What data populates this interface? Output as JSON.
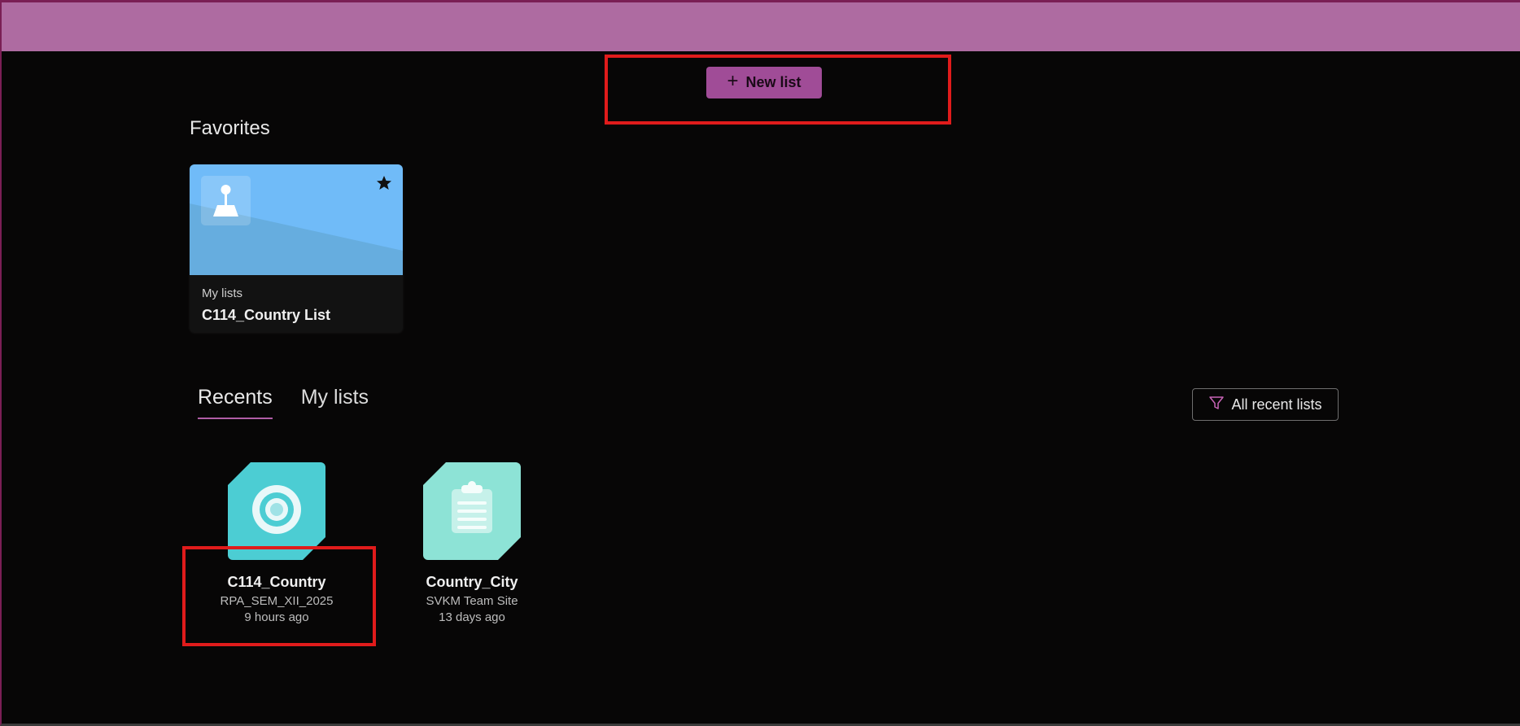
{
  "header": {
    "band_color": "#ae6ba1"
  },
  "toolbar": {
    "new_list_label": "New list",
    "accent": "#a04c97"
  },
  "favorites": {
    "title": "Favorites",
    "cards": [
      {
        "subtitle": "My lists",
        "title": "C114_Country List",
        "starred": true,
        "icon": "joystick-icon",
        "color": "#6fb8f7"
      }
    ]
  },
  "tabs": [
    {
      "label": "Recents",
      "active": true
    },
    {
      "label": "My lists",
      "active": false
    }
  ],
  "filter": {
    "label": "All recent lists",
    "icon": "filter-icon"
  },
  "recents": [
    {
      "name": "C114_Country",
      "site": "RPA_SEM_XII_2025",
      "time": "9 hours ago",
      "icon": "target-icon",
      "color": "#4ccdd3"
    },
    {
      "name": "Country_City",
      "site": "SVKM Team Site",
      "time": "13 days ago",
      "icon": "clipboard-icon",
      "color": "#8de3d6"
    }
  ]
}
